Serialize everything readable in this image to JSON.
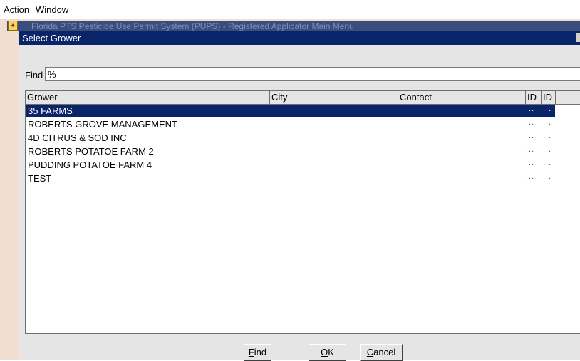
{
  "menubar": {
    "items": [
      {
        "accel": "A",
        "rest": "ction"
      },
      {
        "accel": "W",
        "rest": "indow"
      }
    ]
  },
  "background_window": {
    "title": "Florida PTS Pesticide Use Permit System (PUPS) - Registered Applicator Main Menu"
  },
  "dialog": {
    "title": "Select Grower",
    "find_label": "Find",
    "find_value": "%",
    "columns": [
      "Grower",
      "City",
      "Contact",
      "ID",
      "ID"
    ],
    "rows": [
      {
        "grower": "35 FARMS",
        "city": "",
        "contact": "",
        "id1": "...",
        "id2": "...",
        "selected": true
      },
      {
        "grower": "ROBERTS GROVE MANAGEMENT",
        "city": "",
        "contact": "",
        "id1": "...",
        "id2": "...",
        "selected": false
      },
      {
        "grower": "4D CITRUS & SOD INC",
        "city": "",
        "contact": "",
        "id1": "...",
        "id2": "...",
        "selected": false
      },
      {
        "grower": "ROBERTS POTATOE FARM 2",
        "city": "",
        "contact": "",
        "id1": "...",
        "id2": "...",
        "selected": false
      },
      {
        "grower": "PUDDING POTATOE FARM 4",
        "city": "",
        "contact": "",
        "id1": "...",
        "id2": "...",
        "selected": false
      },
      {
        "grower": "TEST",
        "city": "",
        "contact": "",
        "id1": "...",
        "id2": "...",
        "selected": false
      }
    ],
    "buttons": {
      "find": {
        "accel": "F",
        "rest": "ind"
      },
      "ok": {
        "accel": "O",
        "rest": "K"
      },
      "cancel": {
        "accel": "C",
        "rest": "ancel"
      }
    }
  },
  "colors": {
    "selection": "#0a246a",
    "dialog_bg": "#e5e5e5",
    "side_strip": "#f2ded0"
  }
}
